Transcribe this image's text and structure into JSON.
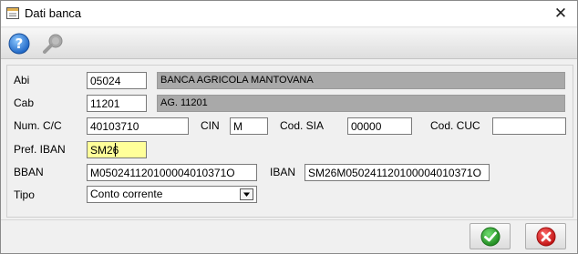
{
  "window": {
    "title": "Dati banca",
    "close_glyph": "✕",
    "icons": {
      "window": "window-icon",
      "close": "close-icon"
    }
  },
  "toolbar": {
    "icons": {
      "help": "help-icon",
      "search": "search-icon"
    }
  },
  "form": {
    "abi": {
      "label": "Abi",
      "value": "05024",
      "description": "BANCA AGRICOLA MANTOVANA"
    },
    "cab": {
      "label": "Cab",
      "value": "11201",
      "description": "AG. 11201"
    },
    "num_cc": {
      "label": "Num. C/C",
      "value": "40103710"
    },
    "cin": {
      "label": "CIN",
      "value": "M"
    },
    "cod_sia": {
      "label": "Cod. SIA",
      "value": "00000"
    },
    "cod_cuc": {
      "label": "Cod. CUC",
      "value": ""
    },
    "pref_iban": {
      "label": "Pref. IBAN",
      "value": "SM26"
    },
    "bban": {
      "label": "BBAN",
      "value": "M050241120100004010371O"
    },
    "iban": {
      "label": "IBAN",
      "value": "SM26M050241120100004010371O"
    },
    "tipo": {
      "label": "Tipo",
      "value": "Conto corrente"
    }
  },
  "buttons": {
    "confirm_icon": "checkmark-icon",
    "cancel_icon": "x-circle-icon"
  },
  "colors": {
    "readonly_bg": "#a9a9a9",
    "focus_bg": "#ffff99",
    "help_blue": "#2a7fd4",
    "confirm_green": "#2e9e2e",
    "cancel_red": "#d32020"
  }
}
